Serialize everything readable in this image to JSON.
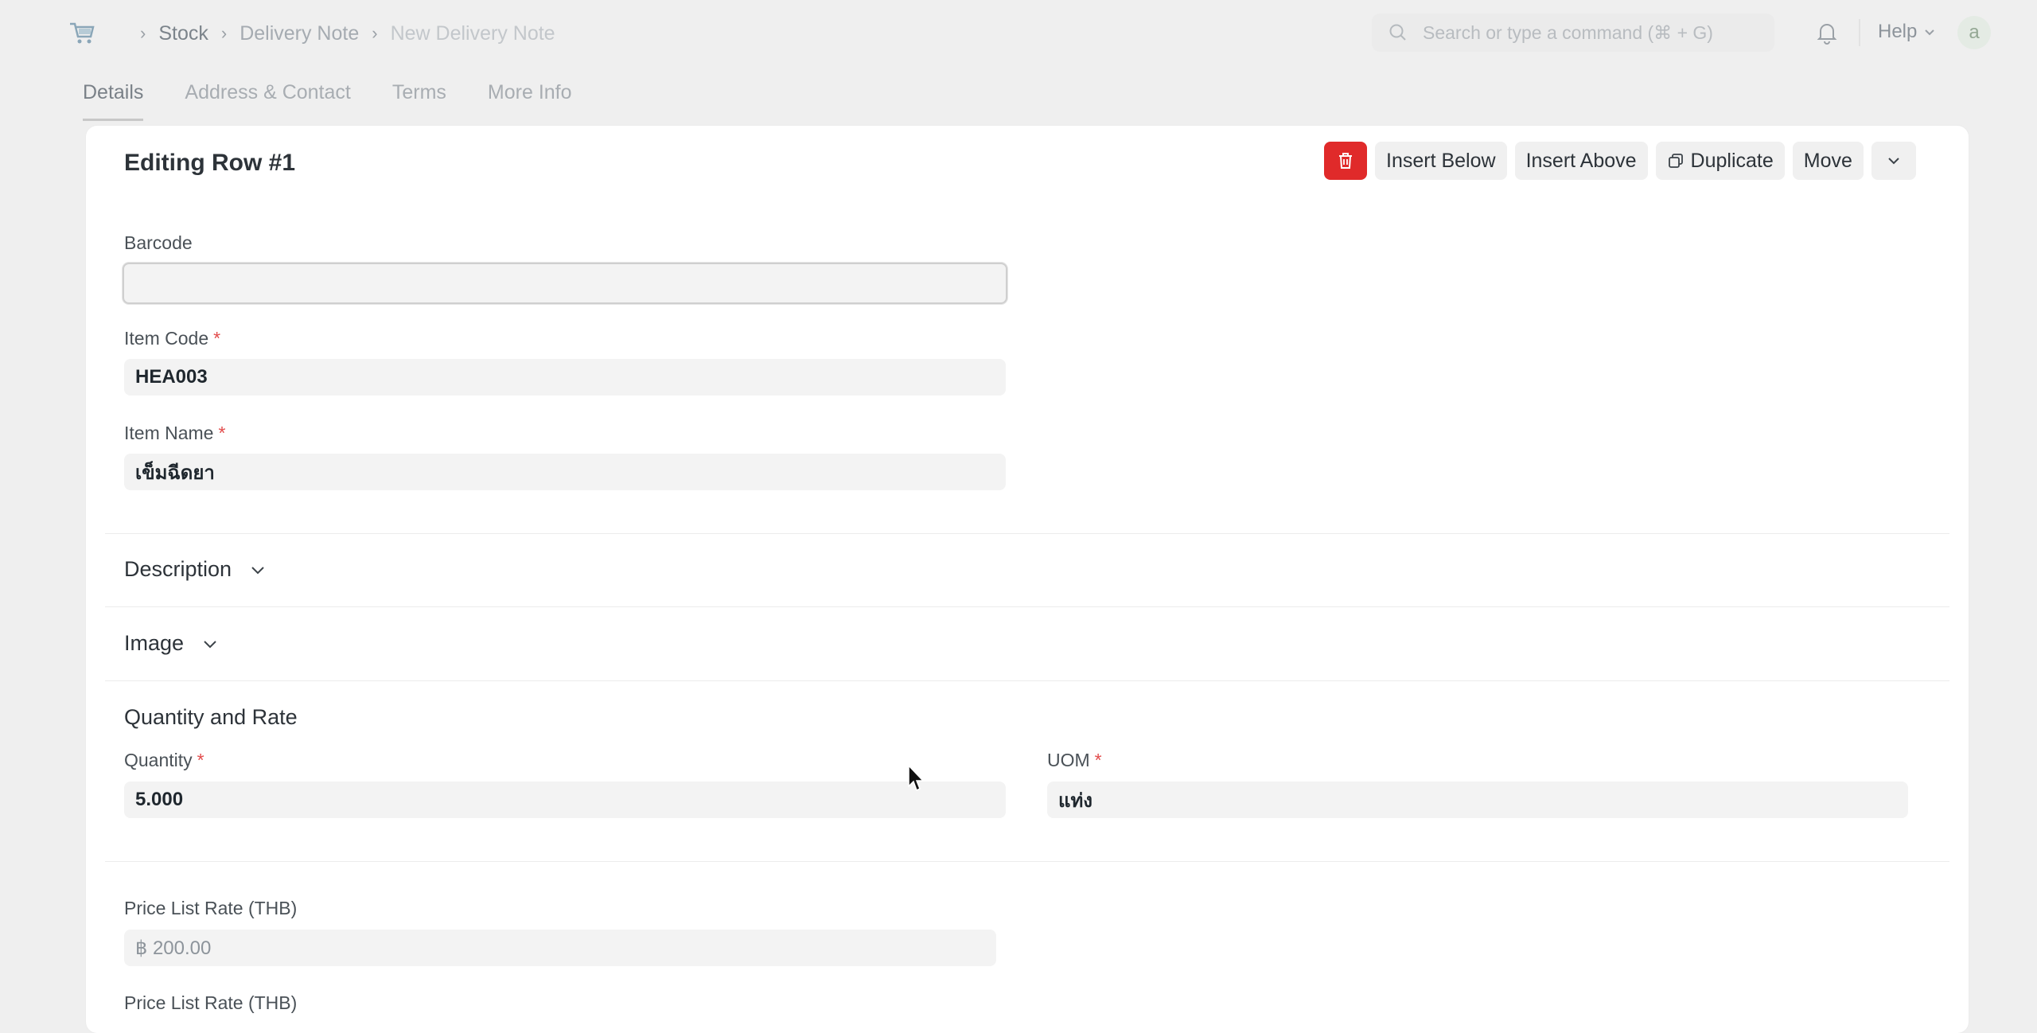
{
  "navbar": {
    "breadcrumbs": [
      "Stock",
      "Delivery Note",
      "New Delivery Note"
    ],
    "search_placeholder": "Search or type a command (⌘ + G)",
    "help_label": "Help",
    "avatar_initial": "a"
  },
  "tabs": [
    {
      "label": "Details",
      "active": true
    },
    {
      "label": "Address & Contact",
      "active": false
    },
    {
      "label": "Terms",
      "active": false
    },
    {
      "label": "More Info",
      "active": false
    }
  ],
  "editor": {
    "title": "Editing Row #1",
    "actions": {
      "insert_below": "Insert Below",
      "insert_above": "Insert Above",
      "duplicate": "Duplicate",
      "move": "Move"
    }
  },
  "fields": {
    "barcode": {
      "label": "Barcode",
      "value": ""
    },
    "item_code": {
      "label": "Item Code",
      "value": "HEA003",
      "required": true
    },
    "item_name": {
      "label": "Item Name",
      "value": "เข็มฉีดยา",
      "required": true
    },
    "quantity": {
      "label": "Quantity",
      "value": "5.000",
      "required": true
    },
    "uom": {
      "label": "UOM",
      "value": "แท่ง",
      "required": true
    },
    "price_list_rate": {
      "label": "Price List Rate (THB)",
      "value": "฿ 200.00"
    },
    "price_list_rate_2": {
      "label": "Price List Rate (THB)"
    }
  },
  "sections": {
    "description": "Description",
    "image": "Image",
    "quantity_and_rate": "Quantity and Rate"
  },
  "colors": {
    "danger": "#e02a2a",
    "required": "#e24c4c",
    "background": "#efefef"
  }
}
